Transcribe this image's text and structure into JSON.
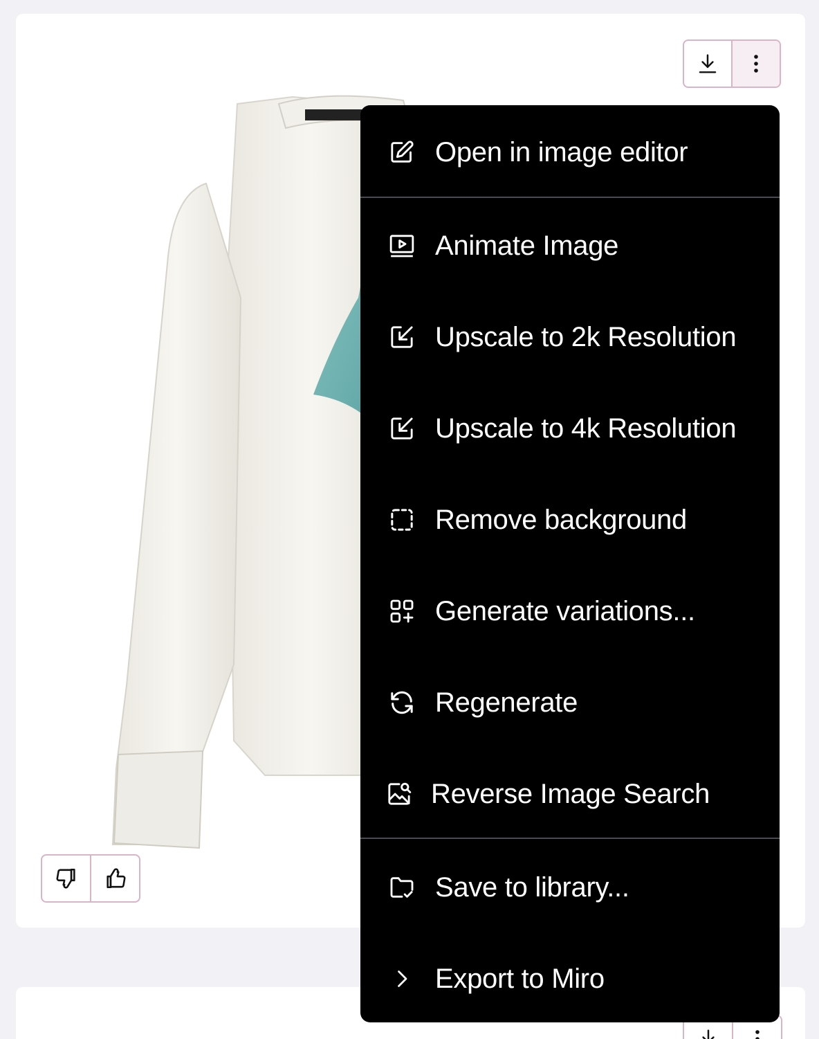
{
  "card": {
    "product_image_alt": "White blouse with teal ruffle",
    "download_label": "Download",
    "more_label": "More options",
    "feedback": {
      "dislike_label": "Dislike",
      "like_label": "Like"
    }
  },
  "menu": {
    "items": [
      {
        "label": "Open in image editor",
        "icon": "edit-icon"
      },
      {
        "label": "Animate Image",
        "icon": "play-screen-icon"
      },
      {
        "label": "Upscale to 2k Resolution",
        "icon": "upscale-icon"
      },
      {
        "label": "Upscale to 4k Resolution",
        "icon": "upscale-icon"
      },
      {
        "label": "Remove background",
        "icon": "dashed-square-icon"
      },
      {
        "label": "Generate variations...",
        "icon": "grid-plus-icon"
      },
      {
        "label": "Regenerate",
        "icon": "refresh-icon"
      },
      {
        "label": "Reverse Image Search",
        "icon": "image-search-icon"
      },
      {
        "label": "Save to library...",
        "icon": "folder-check-icon"
      },
      {
        "label": "Export to Miro",
        "icon": "chevron-right-icon"
      }
    ]
  },
  "colors": {
    "page_bg": "#f2f1f5",
    "menu_bg": "#000000",
    "button_border": "#d9b3c6",
    "ruffle": "#6fb3b3"
  }
}
